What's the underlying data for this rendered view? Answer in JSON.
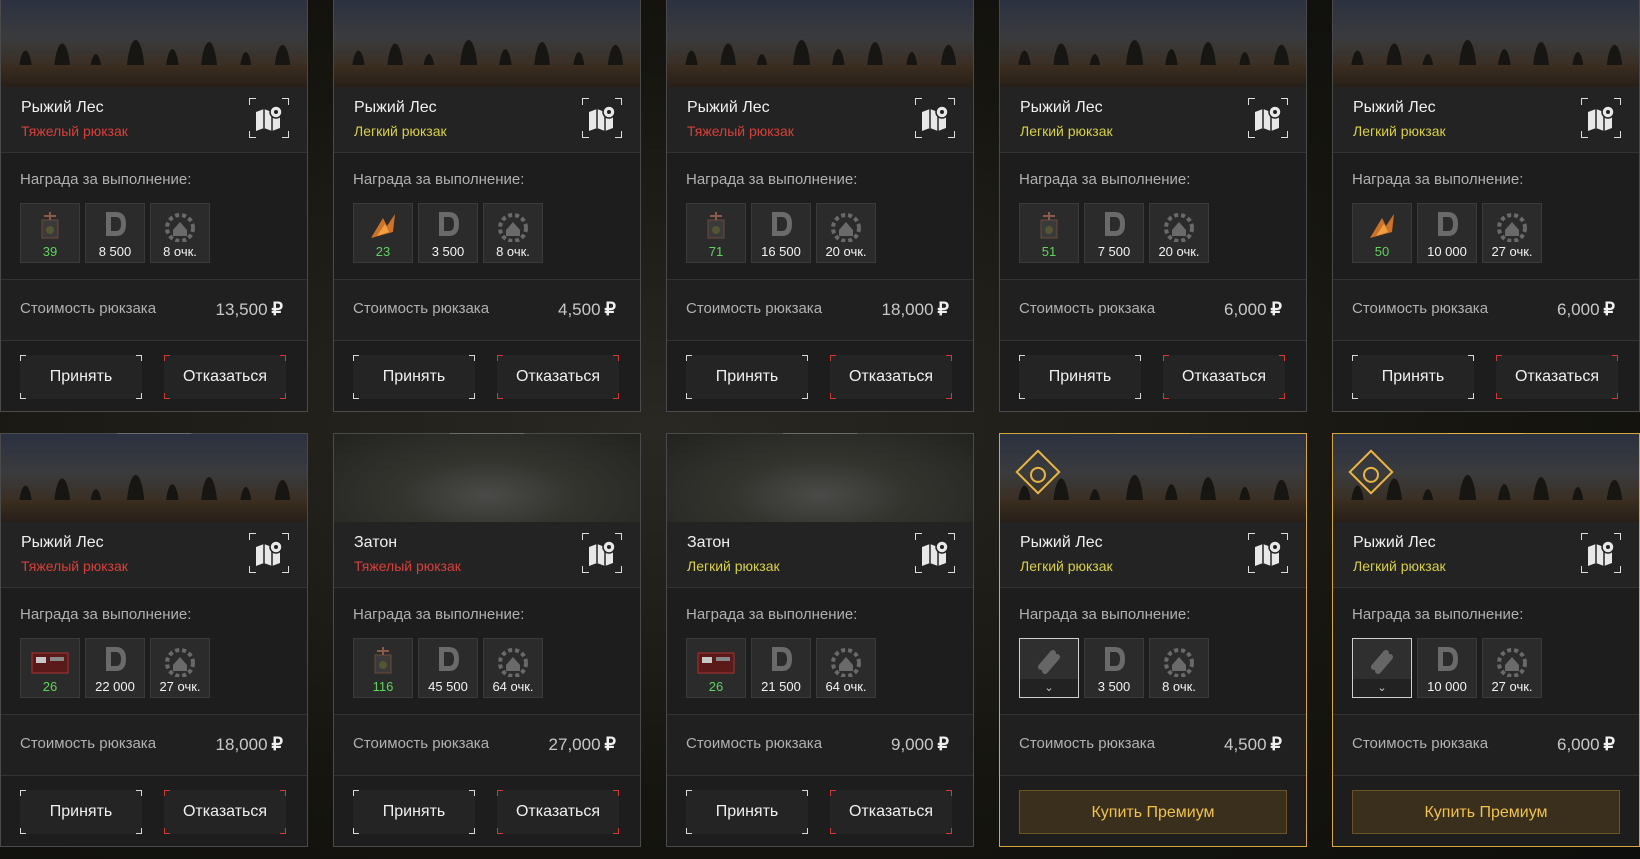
{
  "labels": {
    "reward_title": "Награда за выполнение:",
    "cost_label": "Стоимость рюкзака",
    "accept": "Принять",
    "decline": "Отказаться",
    "buy_premium": "Купить Премиум",
    "currency": "₽",
    "locked_chevron": "⌄"
  },
  "colors": {
    "heavy": "#d93f3a",
    "light": "#d8cf45",
    "premium_gold": "#e9b541",
    "reward_green": "#5fd35f"
  },
  "cards": [
    {
      "location": "Рыжий Лес",
      "type": "Тяжелый рюкзак",
      "weight": "heavy",
      "banner": "forest",
      "item_icon": "gear-item-icon",
      "item_count": "39",
      "money": "8 500",
      "points": "8 очк.",
      "cost": "13,500",
      "premium": false
    },
    {
      "location": "Рыжий Лес",
      "type": "Легкий рюкзак",
      "weight": "light",
      "banner": "forest",
      "item_icon": "flame-item-icon",
      "item_count": "23",
      "money": "3 500",
      "points": "8 очк.",
      "cost": "4,500",
      "premium": false
    },
    {
      "location": "Рыжий Лес",
      "type": "Тяжелый рюкзак",
      "weight": "heavy",
      "banner": "forest",
      "item_icon": "gear-item-icon",
      "item_count": "71",
      "money": "16 500",
      "points": "20 очк.",
      "cost": "18,000",
      "premium": false
    },
    {
      "location": "Рыжий Лес",
      "type": "Легкий рюкзак",
      "weight": "light",
      "banner": "forest",
      "item_icon": "gear-item-icon",
      "item_count": "51",
      "money": "7 500",
      "points": "20 очк.",
      "cost": "6,000",
      "premium": false
    },
    {
      "location": "Рыжий Лес",
      "type": "Легкий рюкзак",
      "weight": "light",
      "banner": "forest",
      "item_icon": "flame-item-icon",
      "item_count": "50",
      "money": "10 000",
      "points": "27 очк.",
      "cost": "6,000",
      "premium": false
    },
    {
      "location": "Рыжий Лес",
      "type": "Тяжелый рюкзак",
      "weight": "heavy",
      "banner": "forest",
      "item_icon": "medkit-item-icon",
      "item_count": "26",
      "money": "22 000",
      "points": "27 очк.",
      "cost": "18,000",
      "premium": false
    },
    {
      "location": "Затон",
      "type": "Тяжелый рюкзак",
      "weight": "heavy",
      "banner": "fog",
      "item_icon": "gear-item-icon",
      "item_count": "116",
      "money": "45 500",
      "points": "64 очк.",
      "cost": "27,000",
      "premium": false
    },
    {
      "location": "Затон",
      "type": "Легкий рюкзак",
      "weight": "light",
      "banner": "fog",
      "item_icon": "medkit-item-icon",
      "item_count": "26",
      "money": "21 500",
      "points": "64 очк.",
      "cost": "9,000",
      "premium": false
    },
    {
      "location": "Рыжий Лес",
      "type": "Легкий рюкзак",
      "weight": "light",
      "banner": "forest",
      "item_icon": "locked-link-icon",
      "item_count": "",
      "money": "3 500",
      "points": "8 очк.",
      "cost": "4,500",
      "premium": true
    },
    {
      "location": "Рыжий Лес",
      "type": "Легкий рюкзак",
      "weight": "light",
      "banner": "forest",
      "item_icon": "locked-link-icon",
      "item_count": "",
      "money": "10 000",
      "points": "27 очк.",
      "cost": "6,000",
      "premium": true
    }
  ]
}
